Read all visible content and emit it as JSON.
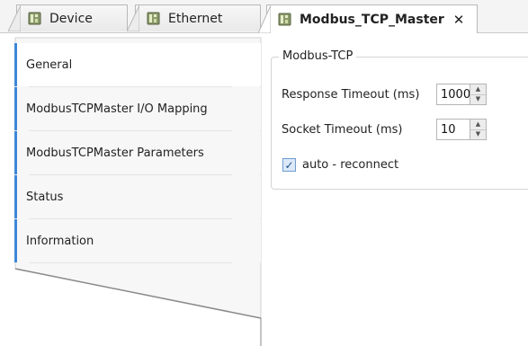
{
  "tabs": [
    {
      "label": "Device",
      "icon": "device-icon",
      "active": false
    },
    {
      "label": "Ethernet",
      "icon": "device-icon",
      "active": false
    },
    {
      "label": "Modbus_TCP_Master",
      "icon": "device-icon",
      "active": true,
      "close": "✕"
    }
  ],
  "sidebar": {
    "items": [
      {
        "label": "General",
        "active": true
      },
      {
        "label": "ModbusTCPMaster I/O Mapping"
      },
      {
        "label": "ModbusTCPMaster Parameters"
      },
      {
        "label": "Status"
      },
      {
        "label": "Information"
      }
    ]
  },
  "modbus_tcp": {
    "group_title": "Modbus-TCP",
    "response_timeout": {
      "label": "Response  Timeout (ms)",
      "value": "1000"
    },
    "socket_timeout": {
      "label": "Socket Timeout (ms)",
      "value": "10"
    },
    "auto_reconnect": {
      "label": "auto - reconnect",
      "checked": true
    }
  },
  "colors": {
    "accent": "#3c87d8",
    "checkbox_fill": "#dbe8f8"
  }
}
